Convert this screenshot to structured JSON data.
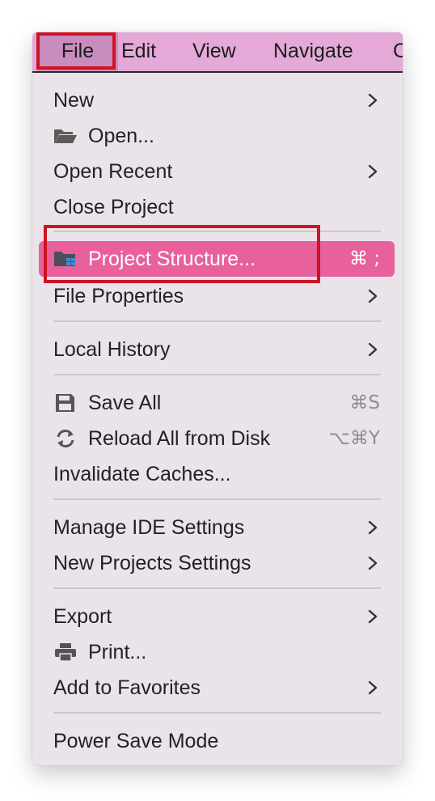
{
  "menubar": {
    "items": [
      {
        "label": "File"
      },
      {
        "label": "Edit"
      },
      {
        "label": "View"
      },
      {
        "label": "Navigate"
      },
      {
        "label": "C"
      }
    ]
  },
  "menu": {
    "new": {
      "label": "New"
    },
    "open": {
      "label": "Open...",
      "icon": "folder-open-icon"
    },
    "open_recent": {
      "label": "Open Recent"
    },
    "close_project": {
      "label": "Close Project"
    },
    "project_structure": {
      "label": "Project Structure...",
      "shortcut": "⌘ ;",
      "icon": "project-structure-icon",
      "highlight_color": "#e8609c"
    },
    "file_properties": {
      "label": "File Properties"
    },
    "local_history": {
      "label": "Local History"
    },
    "save_all": {
      "label": "Save All",
      "shortcut": "⌘S",
      "icon": "save-icon"
    },
    "reload_all": {
      "label": "Reload All from Disk",
      "shortcut": "⌥⌘Y",
      "icon": "reload-icon"
    },
    "invalidate_caches": {
      "label": "Invalidate Caches..."
    },
    "manage_ide_settings": {
      "label": "Manage IDE Settings"
    },
    "new_projects_settings": {
      "label": "New Projects Settings"
    },
    "export": {
      "label": "Export"
    },
    "print": {
      "label": "Print...",
      "icon": "printer-icon"
    },
    "add_to_favorites": {
      "label": "Add to Favorites"
    },
    "power_save_mode": {
      "label": "Power Save Mode"
    }
  },
  "annotation_color": "#cf1322"
}
